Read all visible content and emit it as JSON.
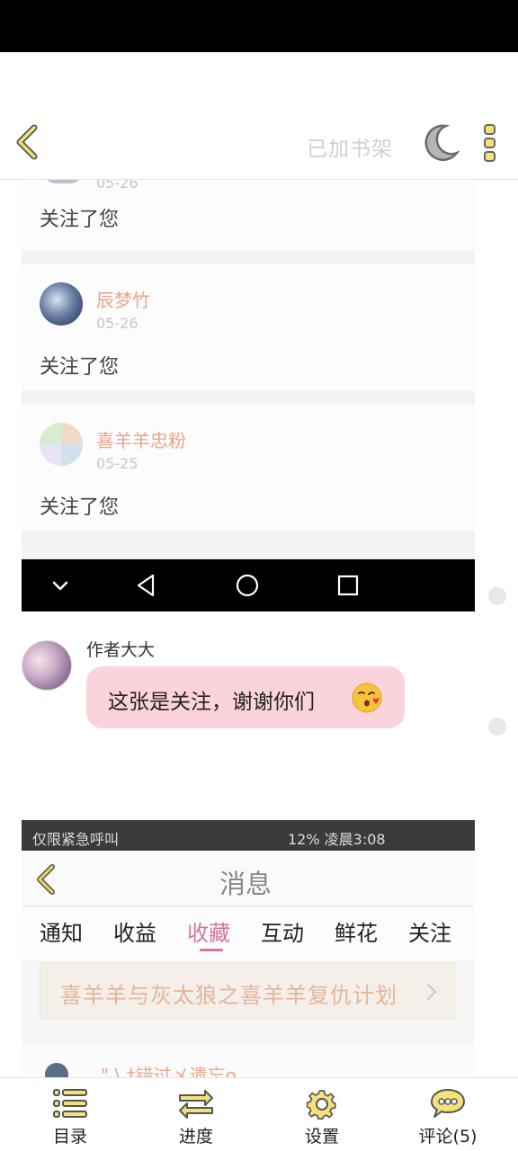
{
  "header": {
    "shelf_label": "已加书架"
  },
  "shot1": {
    "partial_date": "05-26",
    "partial_msg": "关注了您",
    "items": [
      {
        "name": "辰梦竹",
        "date": "05-26",
        "message": "关注了您"
      },
      {
        "name": "喜羊羊忠粉",
        "date": "05-25",
        "message": "关注了您"
      }
    ]
  },
  "chat": {
    "author": "作者大大",
    "message": "这张是关注，谢谢你们"
  },
  "shot2": {
    "status_left": "仅限紧急呼叫",
    "status_right": "12%  凌晨3:08",
    "title": "消息",
    "tabs": [
      "通知",
      "收益",
      "收藏",
      "互动",
      "鲜花",
      "关注"
    ],
    "active_tab": "收藏",
    "banner": "喜羊羊与灰太狼之喜羊羊复仇计划",
    "next_row_name": "\" \\ ‡错过メ遗忘o"
  },
  "toolbar": {
    "items": [
      {
        "label": "目录"
      },
      {
        "label": "进度"
      },
      {
        "label": "设置"
      },
      {
        "label": "评论(5)"
      }
    ]
  },
  "colors": {
    "accent_yellow": "#e6cf55",
    "bubble_pink": "#fbd3da",
    "active_tab": "#d7739f"
  }
}
